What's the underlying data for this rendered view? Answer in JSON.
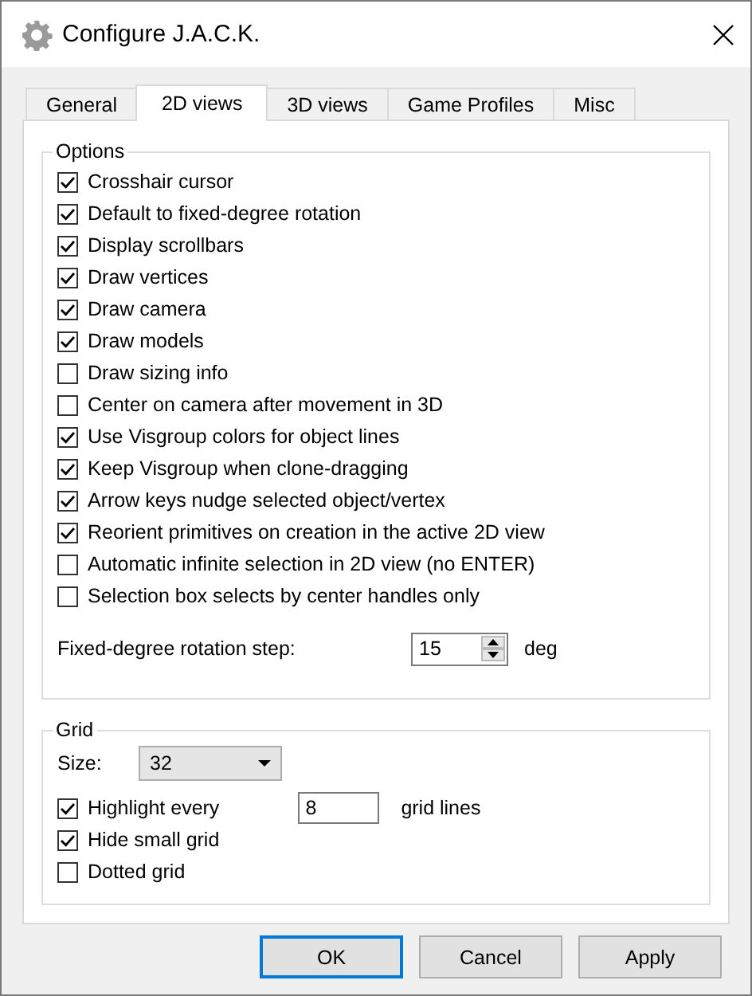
{
  "window": {
    "title": "Configure J.A.C.K."
  },
  "tabs": [
    {
      "label": "General",
      "selected": false
    },
    {
      "label": "2D views",
      "selected": true
    },
    {
      "label": "3D views",
      "selected": false
    },
    {
      "label": "Game Profiles",
      "selected": false
    },
    {
      "label": "Misc",
      "selected": false
    }
  ],
  "options": {
    "title": "Options",
    "items": [
      {
        "label": "Crosshair cursor",
        "checked": true
      },
      {
        "label": "Default to fixed-degree rotation",
        "checked": true
      },
      {
        "label": "Display scrollbars",
        "checked": true
      },
      {
        "label": "Draw vertices",
        "checked": true
      },
      {
        "label": "Draw camera",
        "checked": true
      },
      {
        "label": "Draw models",
        "checked": true
      },
      {
        "label": "Draw sizing info",
        "checked": false
      },
      {
        "label": "Center on camera after movement in 3D",
        "checked": false
      },
      {
        "label": "Use Visgroup colors for object lines",
        "checked": true
      },
      {
        "label": "Keep Visgroup when clone-dragging",
        "checked": true
      },
      {
        "label": "Arrow keys nudge selected object/vertex",
        "checked": true
      },
      {
        "label": "Reorient primitives on creation in the active 2D view",
        "checked": true
      },
      {
        "label": "Automatic infinite selection in 2D view (no ENTER)",
        "checked": false
      },
      {
        "label": "Selection box selects by center handles only",
        "checked": false
      }
    ],
    "rotation_step": {
      "label": "Fixed-degree rotation step:",
      "value": "15",
      "unit": "deg"
    }
  },
  "grid": {
    "title": "Grid",
    "size": {
      "label": "Size:",
      "value": "32"
    },
    "highlight": {
      "label": "Highlight every",
      "checked": true,
      "value": "8",
      "unit": "grid lines"
    },
    "items": [
      {
        "label": "Hide small grid",
        "checked": true
      },
      {
        "label": "Dotted grid",
        "checked": false
      }
    ]
  },
  "buttons": [
    {
      "label": "OK",
      "default": true
    },
    {
      "label": "Cancel",
      "default": false
    },
    {
      "label": "Apply",
      "default": false
    }
  ]
}
